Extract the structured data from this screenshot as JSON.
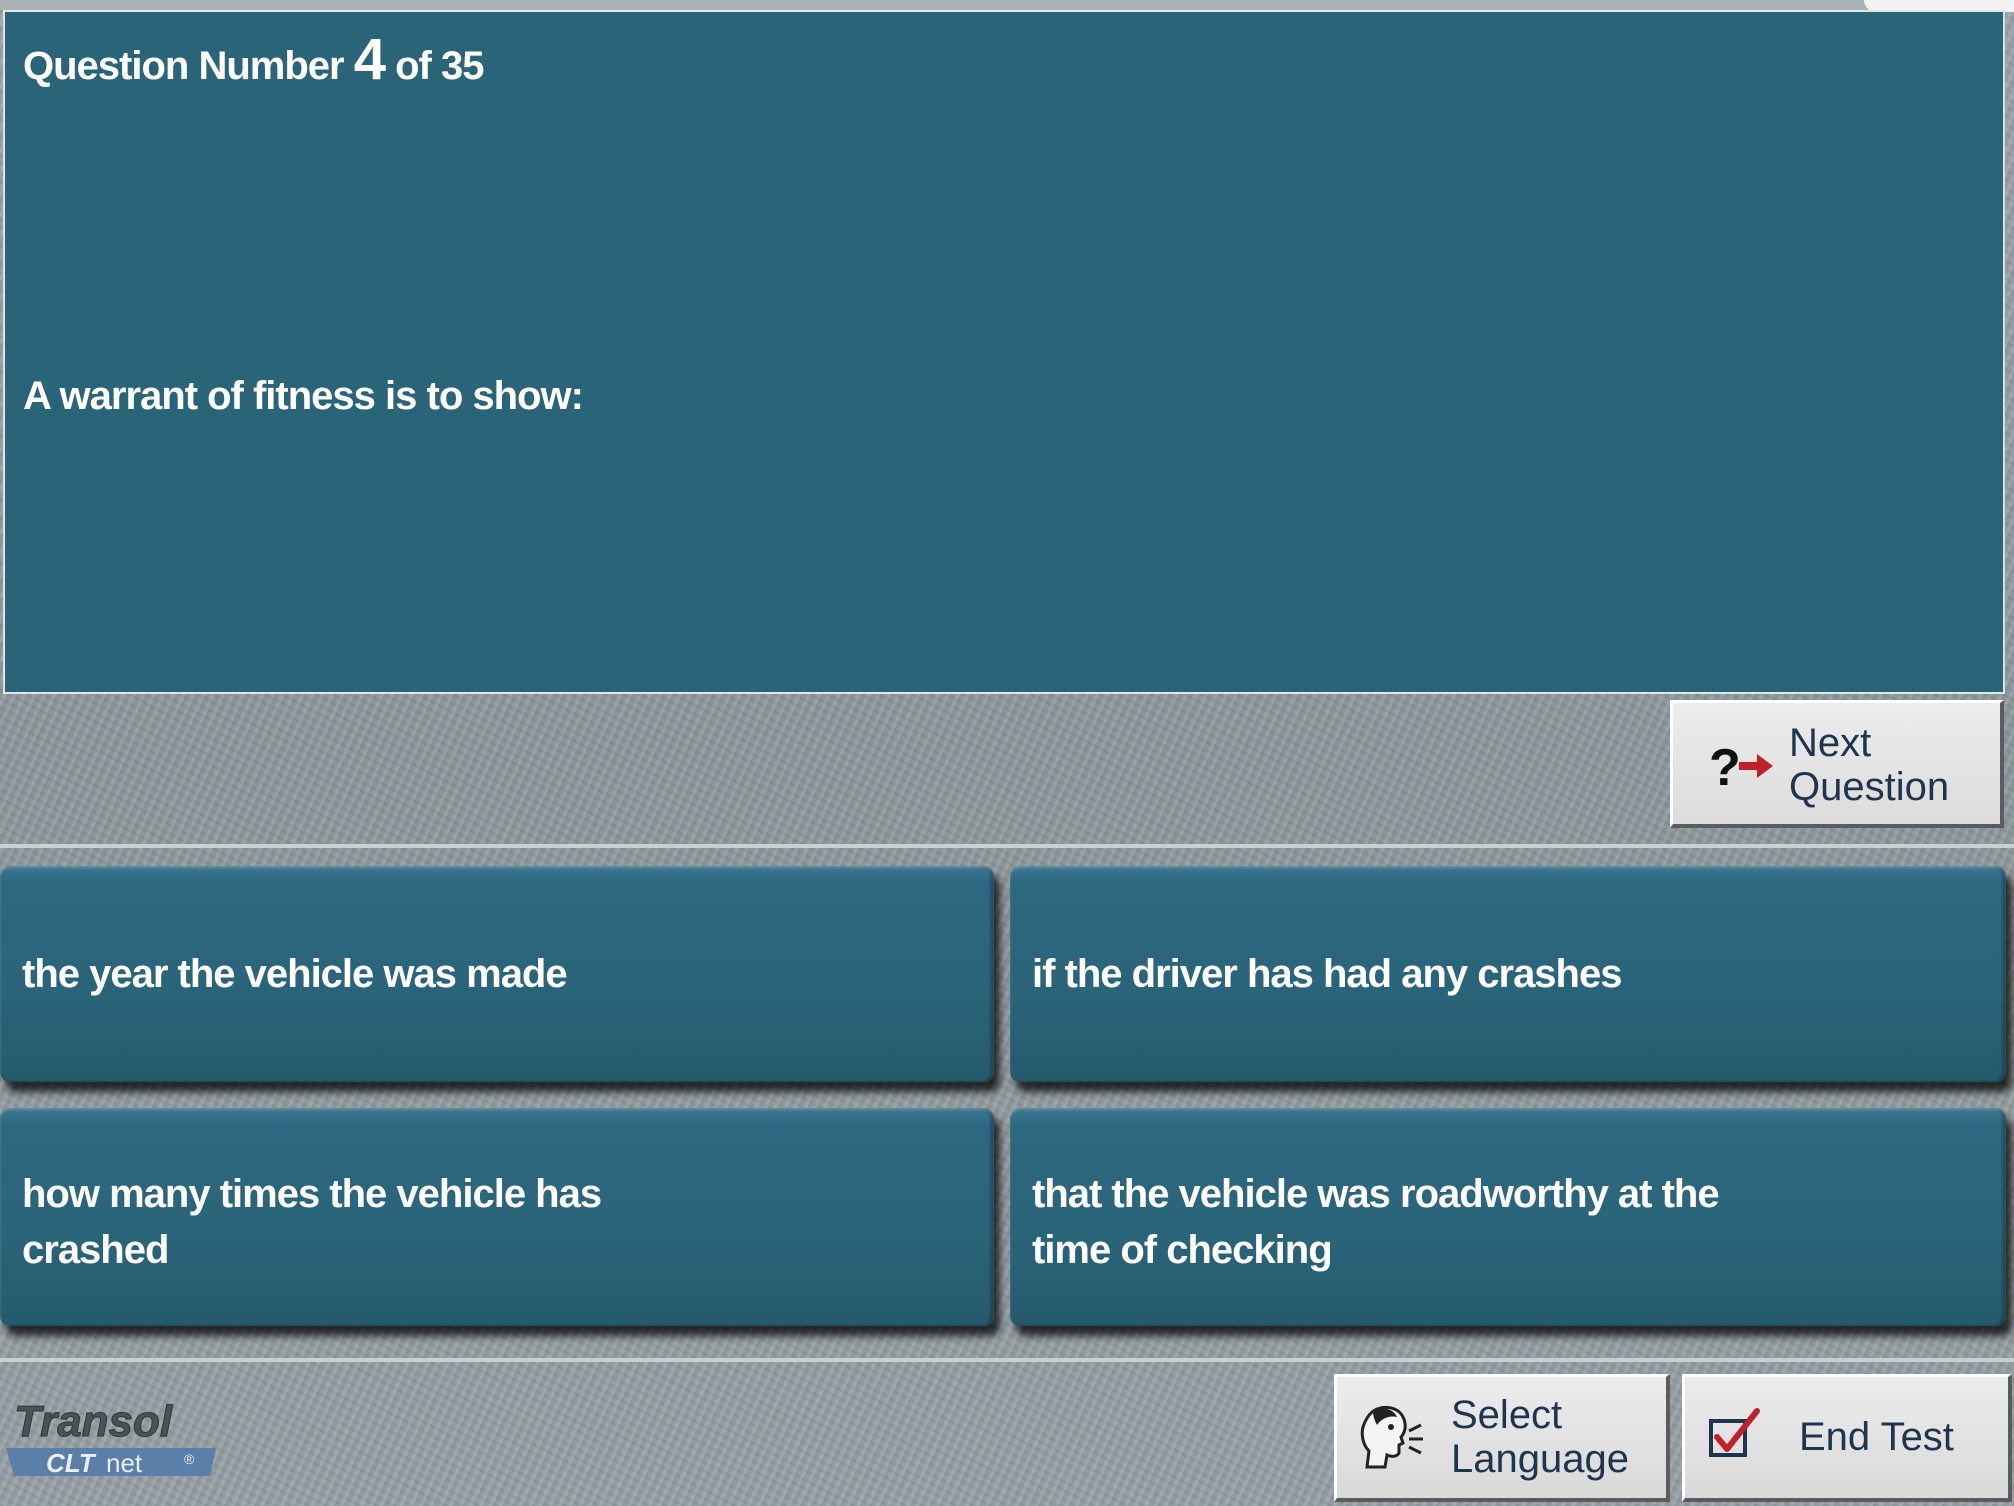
{
  "question": {
    "prefix": "Question Number",
    "number": "4",
    "suffix": "of 35",
    "text": "A warrant of fitness is to show:"
  },
  "answers": [
    {
      "text": "the year the vehicle was made"
    },
    {
      "text": "if the driver has had any crashes"
    },
    {
      "text": "how many times the vehicle has crashed"
    },
    {
      "text": "that the vehicle was roadworthy at the time of checking"
    }
  ],
  "next_button": {
    "line1": "Next",
    "line2": "Question",
    "icon": "question-arrow-icon"
  },
  "select_language_button": {
    "line1": "Select",
    "line2": "Language",
    "icon": "speaking-head-icon"
  },
  "end_test_button": {
    "label": "End Test",
    "icon": "checkbox-tick-icon"
  },
  "logo": {
    "brand": "Transol",
    "sub_bold": "CLT",
    "sub_light": "net",
    "mark": "®"
  },
  "colors": {
    "panel": "#2a6479",
    "button_text": "#1e3550",
    "arrow_red": "#c0202a",
    "background_grey": "#8d979b"
  }
}
